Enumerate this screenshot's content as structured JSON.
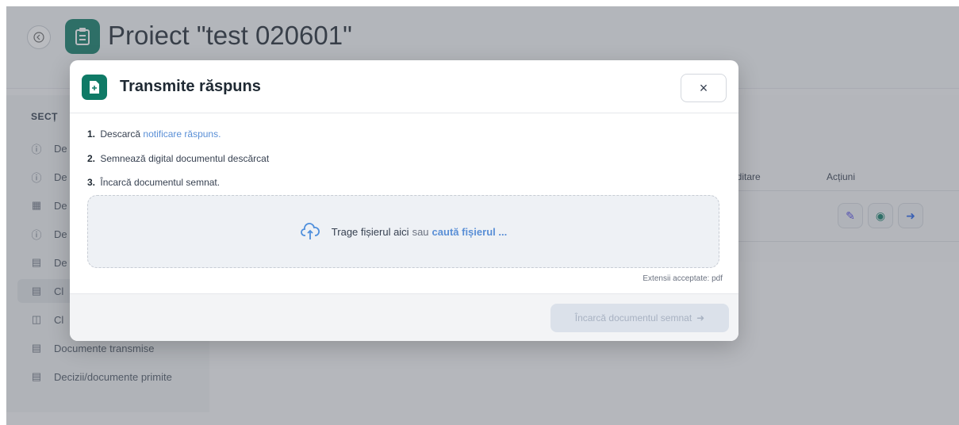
{
  "header": {
    "back_icon": "back-arrow-icon",
    "title": "Proiect \"test 020601\""
  },
  "sidebar": {
    "heading": "SECȚ",
    "items": [
      {
        "label": "De",
        "icon": "info-circle-icon"
      },
      {
        "label": "De",
        "icon": "info-circle-icon"
      },
      {
        "label": "De",
        "icon": "calendar-icon"
      },
      {
        "label": "De",
        "icon": "info-circle-icon"
      },
      {
        "label": "De",
        "icon": "document-icon"
      },
      {
        "label": "Cl",
        "icon": "clipboard-icon"
      },
      {
        "label": "Cl",
        "icon": "chat-icon"
      },
      {
        "label": "Documente transmise",
        "icon": "document-icon"
      },
      {
        "label": "Decizii/documente primite",
        "icon": "document-icon"
      }
    ]
  },
  "table": {
    "col_editare": "editare",
    "col_actiuni": "Acțiuni"
  },
  "modal": {
    "title": "Transmite răspuns",
    "close_label": "×",
    "step1_num": "1.",
    "step1_text": "Descarcă",
    "step1_link": "notificare răspuns.",
    "step2_num": "2.",
    "step2_text": "Semnează digital documentul descărcat",
    "step3_num": "3.",
    "step3_text": "Încarcă documentul semnat.",
    "drop_text": "Trage fișierul aici",
    "drop_or": "sau",
    "drop_link": "caută fișierul ...",
    "ext_note": "Extensii acceptate: pdf",
    "upload_button": "Încarcă documentul semnat"
  },
  "colors": {
    "accent": "#0f7a66",
    "link": "#5a8fd6"
  }
}
